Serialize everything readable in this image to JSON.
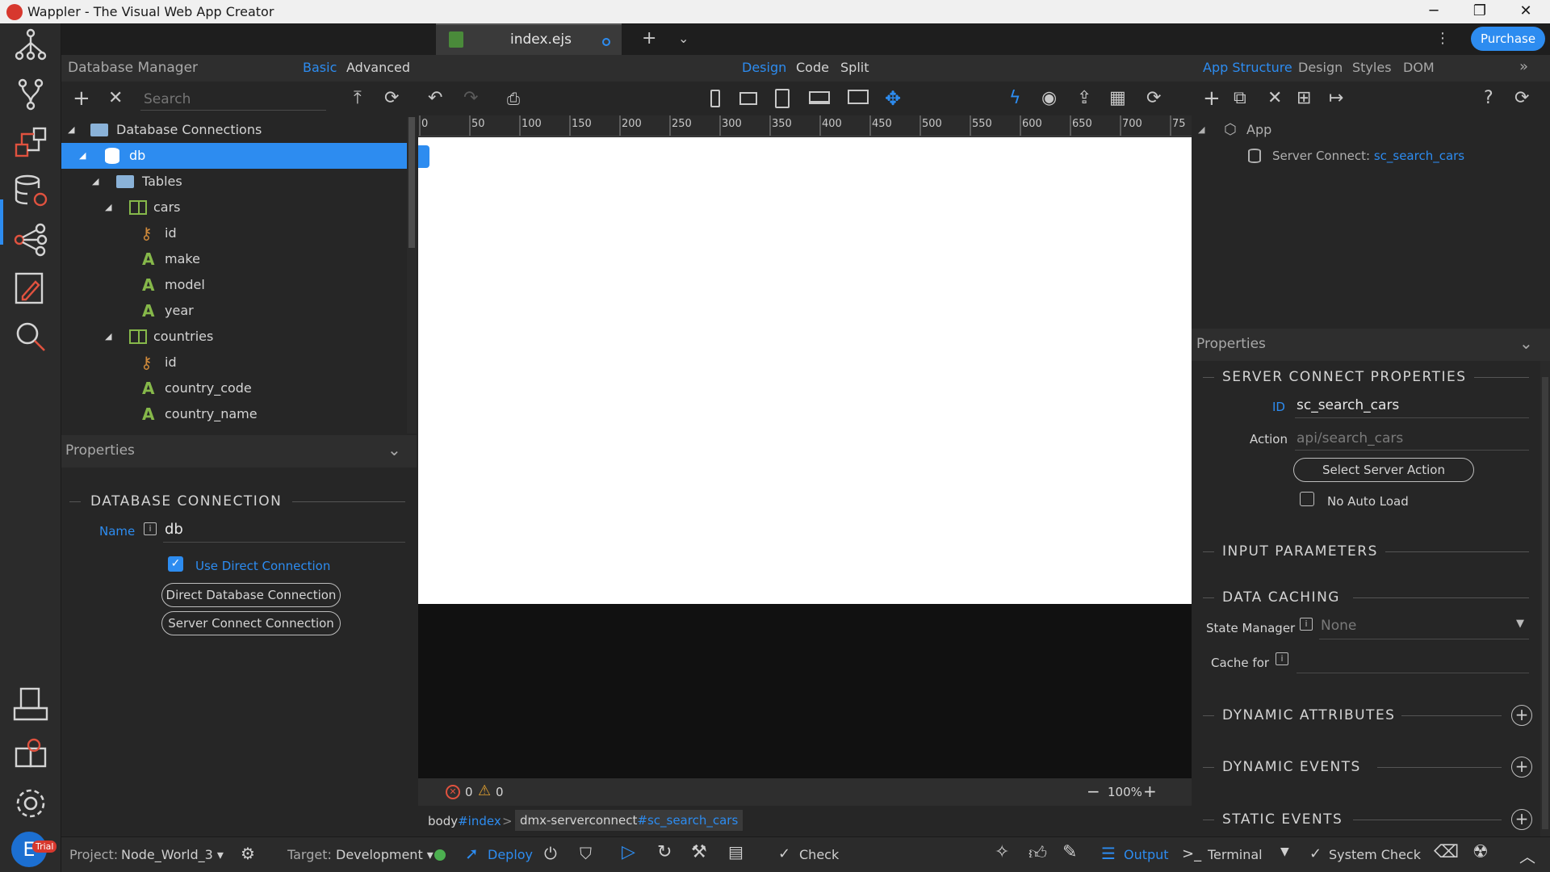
{
  "window": {
    "title": "Wappler - The Visual Web App Creator"
  },
  "tabbar": {
    "file_tab": "index.ejs",
    "purchase": "Purchase"
  },
  "left_panel": {
    "title": "Database Manager",
    "tabs": [
      "Basic",
      "Advanced"
    ],
    "search_placeholder": "Search",
    "tree": {
      "root": "Database Connections",
      "db": "db",
      "tables": "Tables",
      "cars": "cars",
      "cars_fields": [
        "id",
        "make",
        "model",
        "year"
      ],
      "countries": "countries",
      "countries_fields": [
        "id",
        "country_code",
        "country_name"
      ]
    },
    "properties_title": "Properties",
    "section": "DATABASE CONNECTION",
    "name_label": "Name",
    "name_value": "db",
    "use_direct": "Use Direct Connection",
    "btn_direct": "Direct Database Connection",
    "btn_server": "Server Connect Connection"
  },
  "center": {
    "view_tabs": [
      "Design",
      "Code",
      "Split"
    ],
    "ruler": [
      "0",
      "50",
      "100",
      "150",
      "200",
      "250",
      "300",
      "350",
      "400",
      "450",
      "500",
      "550",
      "600",
      "650",
      "700",
      "75"
    ],
    "errors": "0",
    "warnings": "0",
    "zoom": "100%",
    "breadcrumb_1_tag": "body",
    "breadcrumb_1_id": "#index",
    "breadcrumb_sep": ">",
    "breadcrumb_2_tag": "dmx-serverconnect",
    "breadcrumb_2_id": "#sc_search_cars"
  },
  "right_panel": {
    "tabs": [
      "App Structure",
      "Design",
      "Styles",
      "DOM"
    ],
    "tree_app": "App",
    "tree_sc_label": "Server Connect: ",
    "tree_sc_id": "sc_search_cars",
    "properties_title": "Properties",
    "section_sc": "SERVER CONNECT PROPERTIES",
    "id_label": "ID",
    "id_value": "sc_search_cars",
    "action_label": "Action",
    "action_placeholder": "api/search_cars",
    "select_action_btn": "Select Server Action",
    "no_auto_load": "No Auto Load",
    "section_input": "INPUT PARAMETERS",
    "section_caching": "DATA CACHING",
    "state_manager_label": "State Manager",
    "state_manager_value": "None",
    "cache_for_label": "Cache for",
    "section_dyn_attr": "DYNAMIC ATTRIBUTES",
    "section_dyn_events": "DYNAMIC EVENTS",
    "section_static_events": "STATIC EVENTS"
  },
  "statusbar": {
    "project_label": "Project:",
    "project_value": "Node_World_3",
    "target_label": "Target:",
    "target_value": "Development",
    "deploy": "Deploy",
    "check": "Check",
    "output": "Output",
    "terminal": "Terminal",
    "system_check": "System Check",
    "user_initial": "E",
    "trial": "Trial"
  }
}
